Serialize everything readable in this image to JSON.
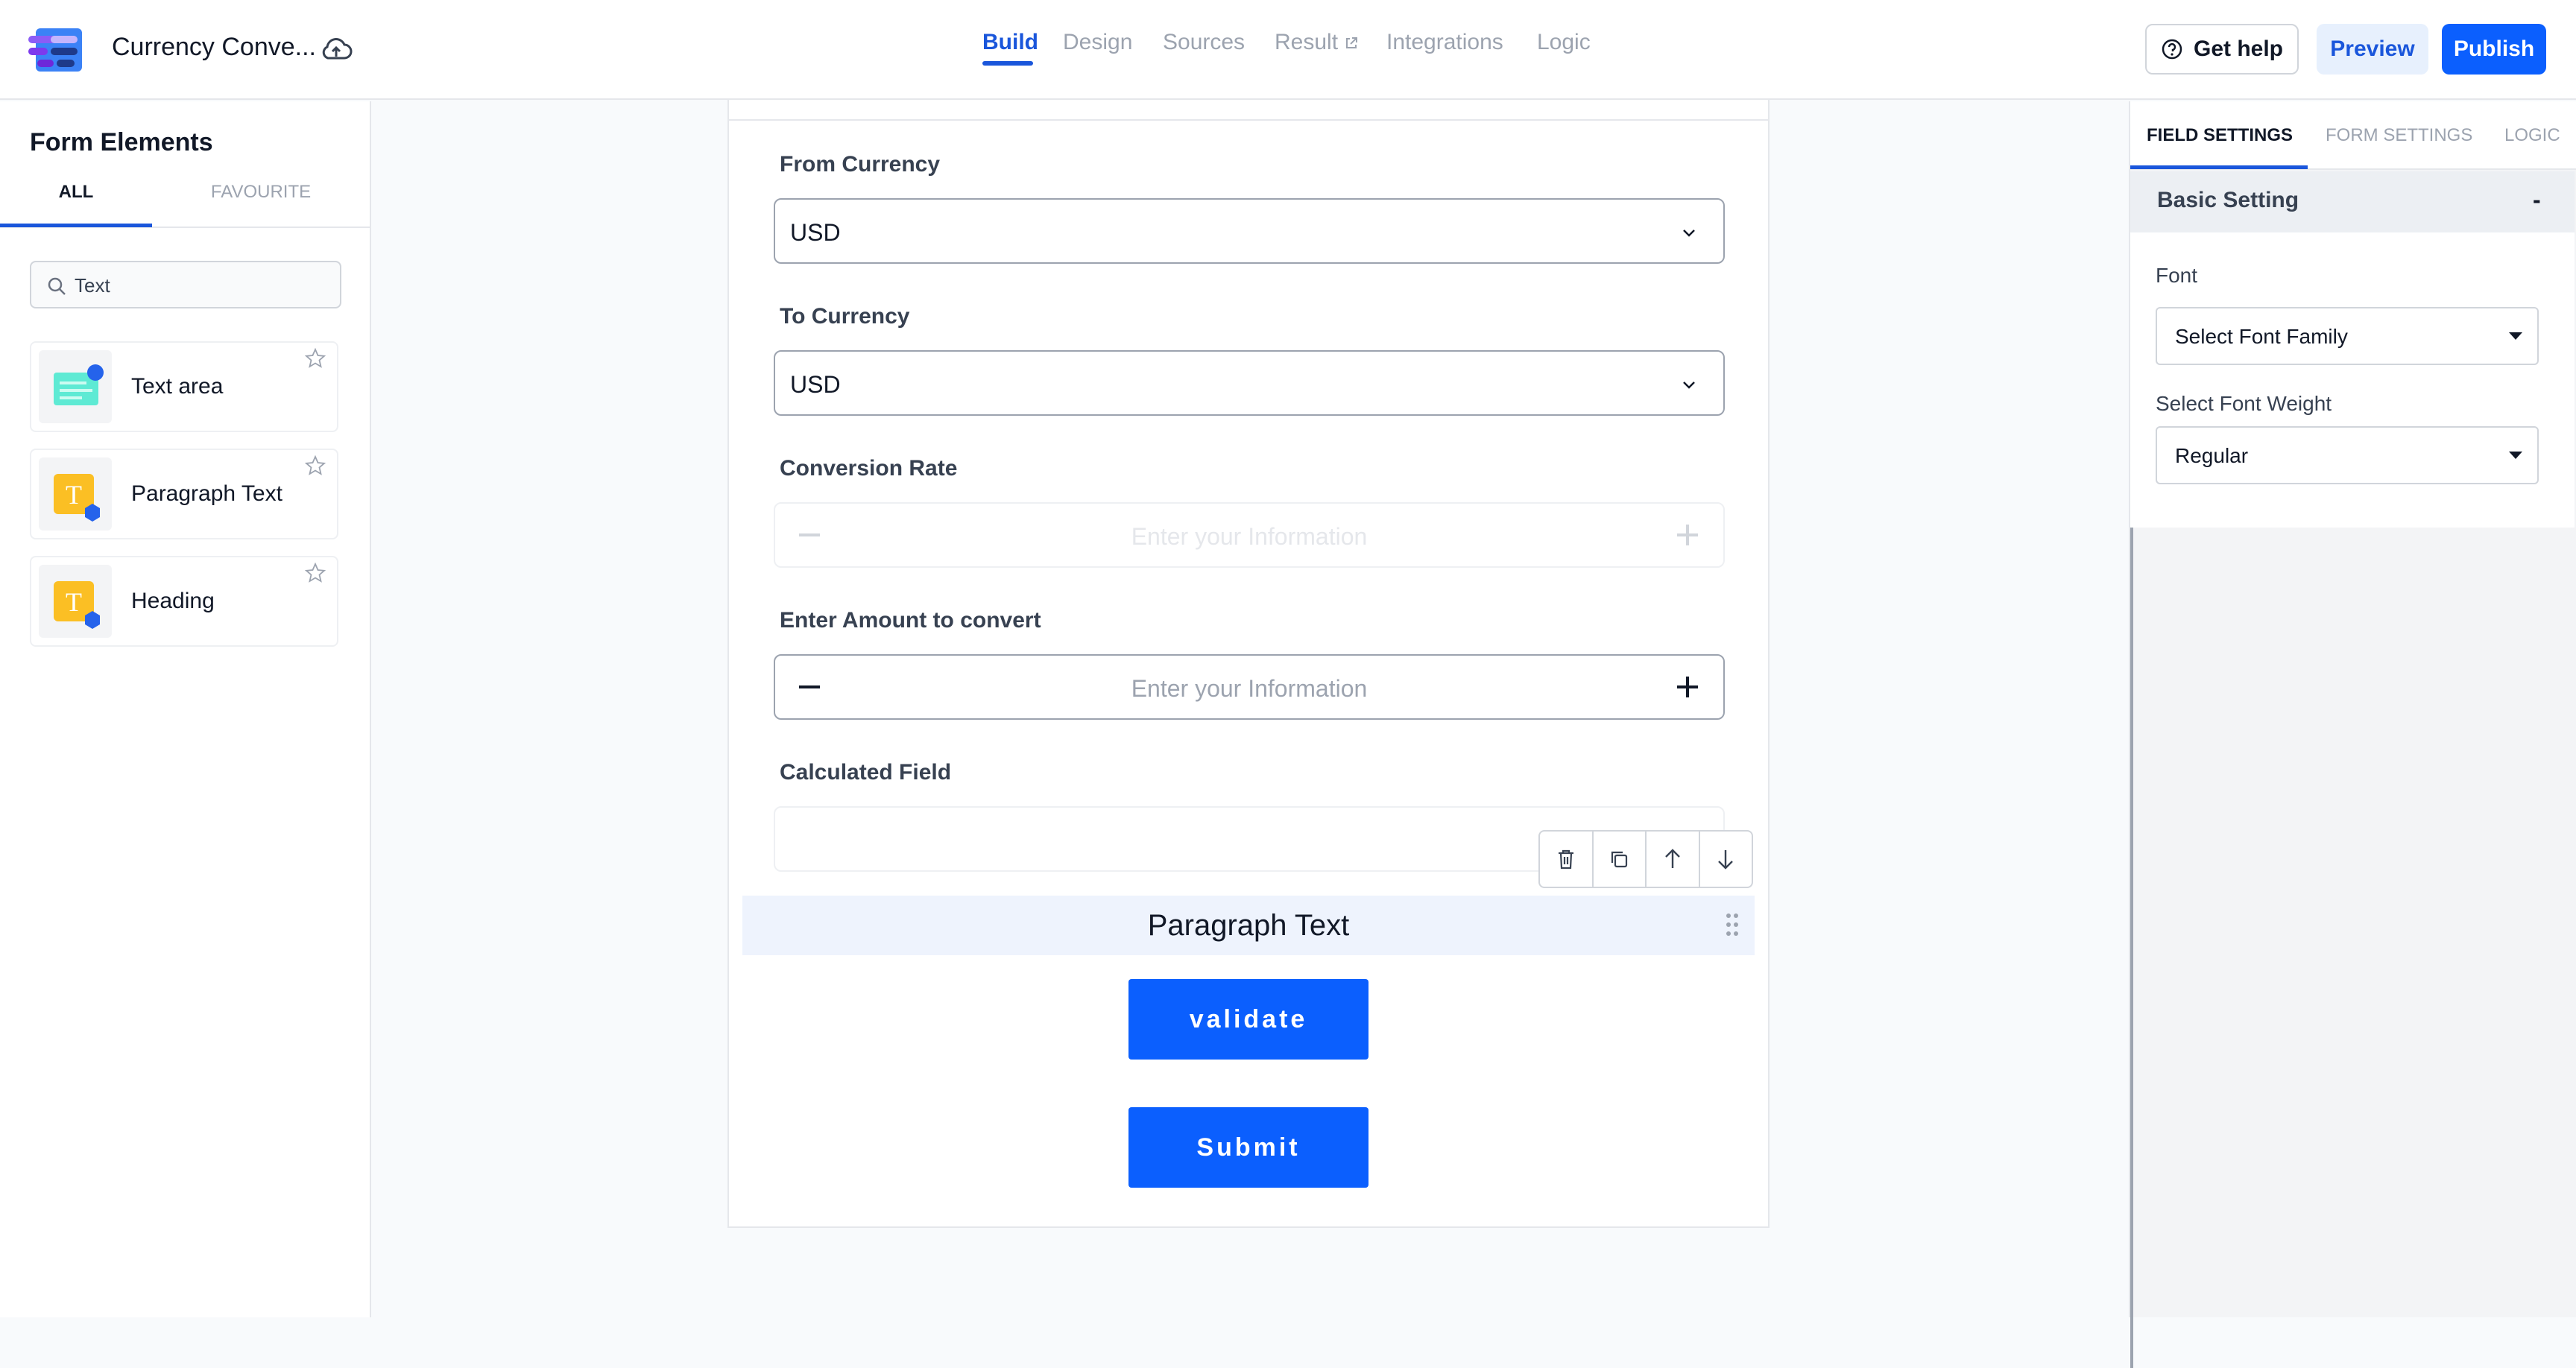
{
  "header": {
    "app_title": "Currency Conve...",
    "nav_tabs": [
      "Build",
      "Design",
      "Sources",
      "Result",
      "Integrations",
      "Logic"
    ],
    "active_tab": "Build",
    "help_label": "Get help",
    "preview_label": "Preview",
    "publish_label": "Publish"
  },
  "left_panel": {
    "title": "Form Elements",
    "tabs": [
      "ALL",
      "FAVOURITE"
    ],
    "search_value": "Text",
    "elements": [
      {
        "label": "Text area",
        "icon": "text-area-icon"
      },
      {
        "label": "Paragraph Text",
        "icon": "paragraph-text-icon"
      },
      {
        "label": "Heading",
        "icon": "heading-icon"
      }
    ]
  },
  "form": {
    "from_currency": {
      "label": "From Currency",
      "value": "USD"
    },
    "to_currency": {
      "label": "To Currency",
      "value": "USD"
    },
    "conversion_rate": {
      "label": "Conversion Rate",
      "placeholder": "Enter your Information"
    },
    "amount": {
      "label": "Enter Amount to convert",
      "placeholder": "Enter your Information"
    },
    "calculated": {
      "label": "Calculated Field"
    },
    "paragraph_text": "Paragraph Text",
    "validate_label": "validate",
    "submit_label": "Submit"
  },
  "right_panel": {
    "tabs": [
      "FIELD SETTINGS",
      "FORM SETTINGS",
      "LOGIC"
    ],
    "section_title": "Basic Setting",
    "section_toggle": "-",
    "font_label": "Font",
    "font_value": "Select Font Family",
    "weight_label": "Select Font Weight",
    "weight_value": "Regular"
  },
  "colors": {
    "accent": "#0b5ffe",
    "link_blue": "#1a56db",
    "selected_block": "#eef3fd"
  }
}
